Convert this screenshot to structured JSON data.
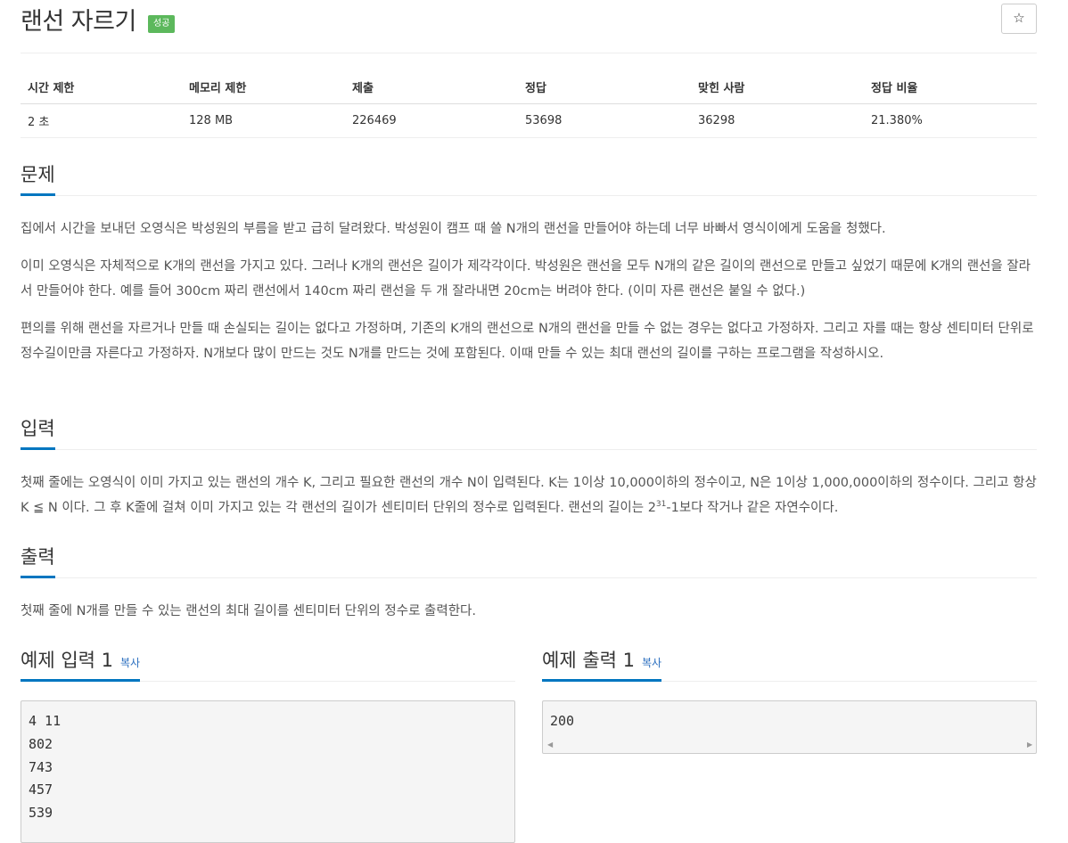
{
  "problem": {
    "title": "랜선 자르기",
    "badge": "성공",
    "star_icon": "☆"
  },
  "info_table": {
    "headers": [
      "시간 제한",
      "메모리 제한",
      "제출",
      "정답",
      "맞힌 사람",
      "정답 비율"
    ],
    "values": [
      "2 초",
      "128 MB",
      "226469",
      "53698",
      "36298",
      "21.380%"
    ]
  },
  "sections": {
    "problem_title": "문제",
    "problem_p1": "집에서 시간을 보내던 오영식은 박성원의 부름을 받고 급히 달려왔다. 박성원이 캠프 때 쓸 N개의 랜선을 만들어야 하는데 너무 바빠서 영식이에게 도움을 청했다.",
    "problem_p2": "이미 오영식은 자체적으로 K개의 랜선을 가지고 있다. 그러나 K개의 랜선은 길이가 제각각이다. 박성원은 랜선을 모두 N개의 같은 길이의 랜선으로 만들고 싶었기 때문에 K개의 랜선을 잘라서 만들어야 한다. 예를 들어 300cm 짜리 랜선에서 140cm 짜리 랜선을 두 개 잘라내면 20cm는 버려야 한다. (이미 자른 랜선은 붙일 수 없다.)",
    "problem_p3": "편의를 위해 랜선을 자르거나 만들 때 손실되는 길이는 없다고 가정하며, 기존의 K개의 랜선으로 N개의 랜선을 만들 수 없는 경우는 없다고 가정하자. 그리고 자를 때는 항상 센티미터 단위로 정수길이만큼 자른다고 가정하자. N개보다 많이 만드는 것도 N개를 만드는 것에 포함된다. 이때 만들 수 있는 최대 랜선의 길이를 구하는 프로그램을 작성하시오.",
    "input_title": "입력",
    "input_p_a": "첫째 줄에는 오영식이 이미 가지고 있는 랜선의 개수 K, 그리고 필요한 랜선의 개수 N이 입력된다. K는 1이상 10,000이하의 정수이고, N은 1이상 1,000,000이하의 정수이다. 그리고 항상 K ≦ N 이다. 그 후 K줄에 걸쳐 이미 가지고 있는 각 랜선의 길이가 센티미터 단위의 정수로 입력된다. 랜선의 길이는 2",
    "input_p_sup": "31",
    "input_p_b": "-1보다 작거나 같은 자연수이다.",
    "output_title": "출력",
    "output_p": "첫째 줄에 N개를 만들 수 있는 랜선의 최대 길이를 센티미터 단위의 정수로 출력한다."
  },
  "samples": {
    "input_title": "예제 입력 1",
    "output_title": "예제 출력 1",
    "copy_label": "복사",
    "input_text": "4 11\n802\n743\n457\n539",
    "output_text": "200"
  }
}
